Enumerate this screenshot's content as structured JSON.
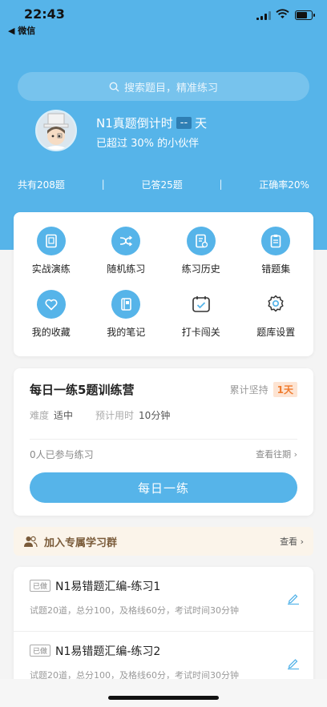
{
  "status_bar": {
    "time": "22:43",
    "back_label": "◀ 微信"
  },
  "search": {
    "placeholder": "搜索题目，精准练习"
  },
  "profile": {
    "countdown_label": "N1真题倒计时",
    "countdown_value": "--",
    "countdown_unit": "天",
    "exceed_text": "已超过 30% 的小伙伴"
  },
  "stats": {
    "total": "共有208题",
    "answered": "已答25题",
    "accuracy": "正确率20%",
    "separator": "|"
  },
  "features": [
    {
      "label": "实战演练",
      "icon": "book-icon"
    },
    {
      "label": "随机练习",
      "icon": "shuffle-icon"
    },
    {
      "label": "练习历史",
      "icon": "history-icon"
    },
    {
      "label": "错题集",
      "icon": "clipboard-icon"
    },
    {
      "label": "我的收藏",
      "icon": "heart-icon"
    },
    {
      "label": "我的笔记",
      "icon": "notebook-icon"
    },
    {
      "label": "打卡闯关",
      "icon": "calendar-check-icon"
    },
    {
      "label": "题库设置",
      "icon": "gear-icon"
    }
  ],
  "daily": {
    "title": "每日一练5题训练营",
    "streak_label": "累计坚持",
    "streak_value": "1天",
    "difficulty_label": "难度",
    "difficulty_value": "适中",
    "time_label": "预计用时",
    "time_value": "10分钟",
    "joined_text": "0人已参与练习",
    "history_link": "查看往期 ›",
    "button_label": "每日一练"
  },
  "group": {
    "label": "加入专属学习群",
    "view_label": "查看 ›"
  },
  "exercises": [
    {
      "badge": "已做",
      "title": "N1易错题汇编-练习1",
      "desc": "试题20道，总分100，及格线60分，考试时间30分钟"
    },
    {
      "badge": "已做",
      "title": "N1易错题汇编-练习2",
      "desc": "试题20道，总分100，及格线60分，考试时间30分钟"
    }
  ],
  "colors": {
    "primary": "#56b4e9",
    "streak": "#ef7b2e",
    "group_bg": "#fbf4ea"
  }
}
